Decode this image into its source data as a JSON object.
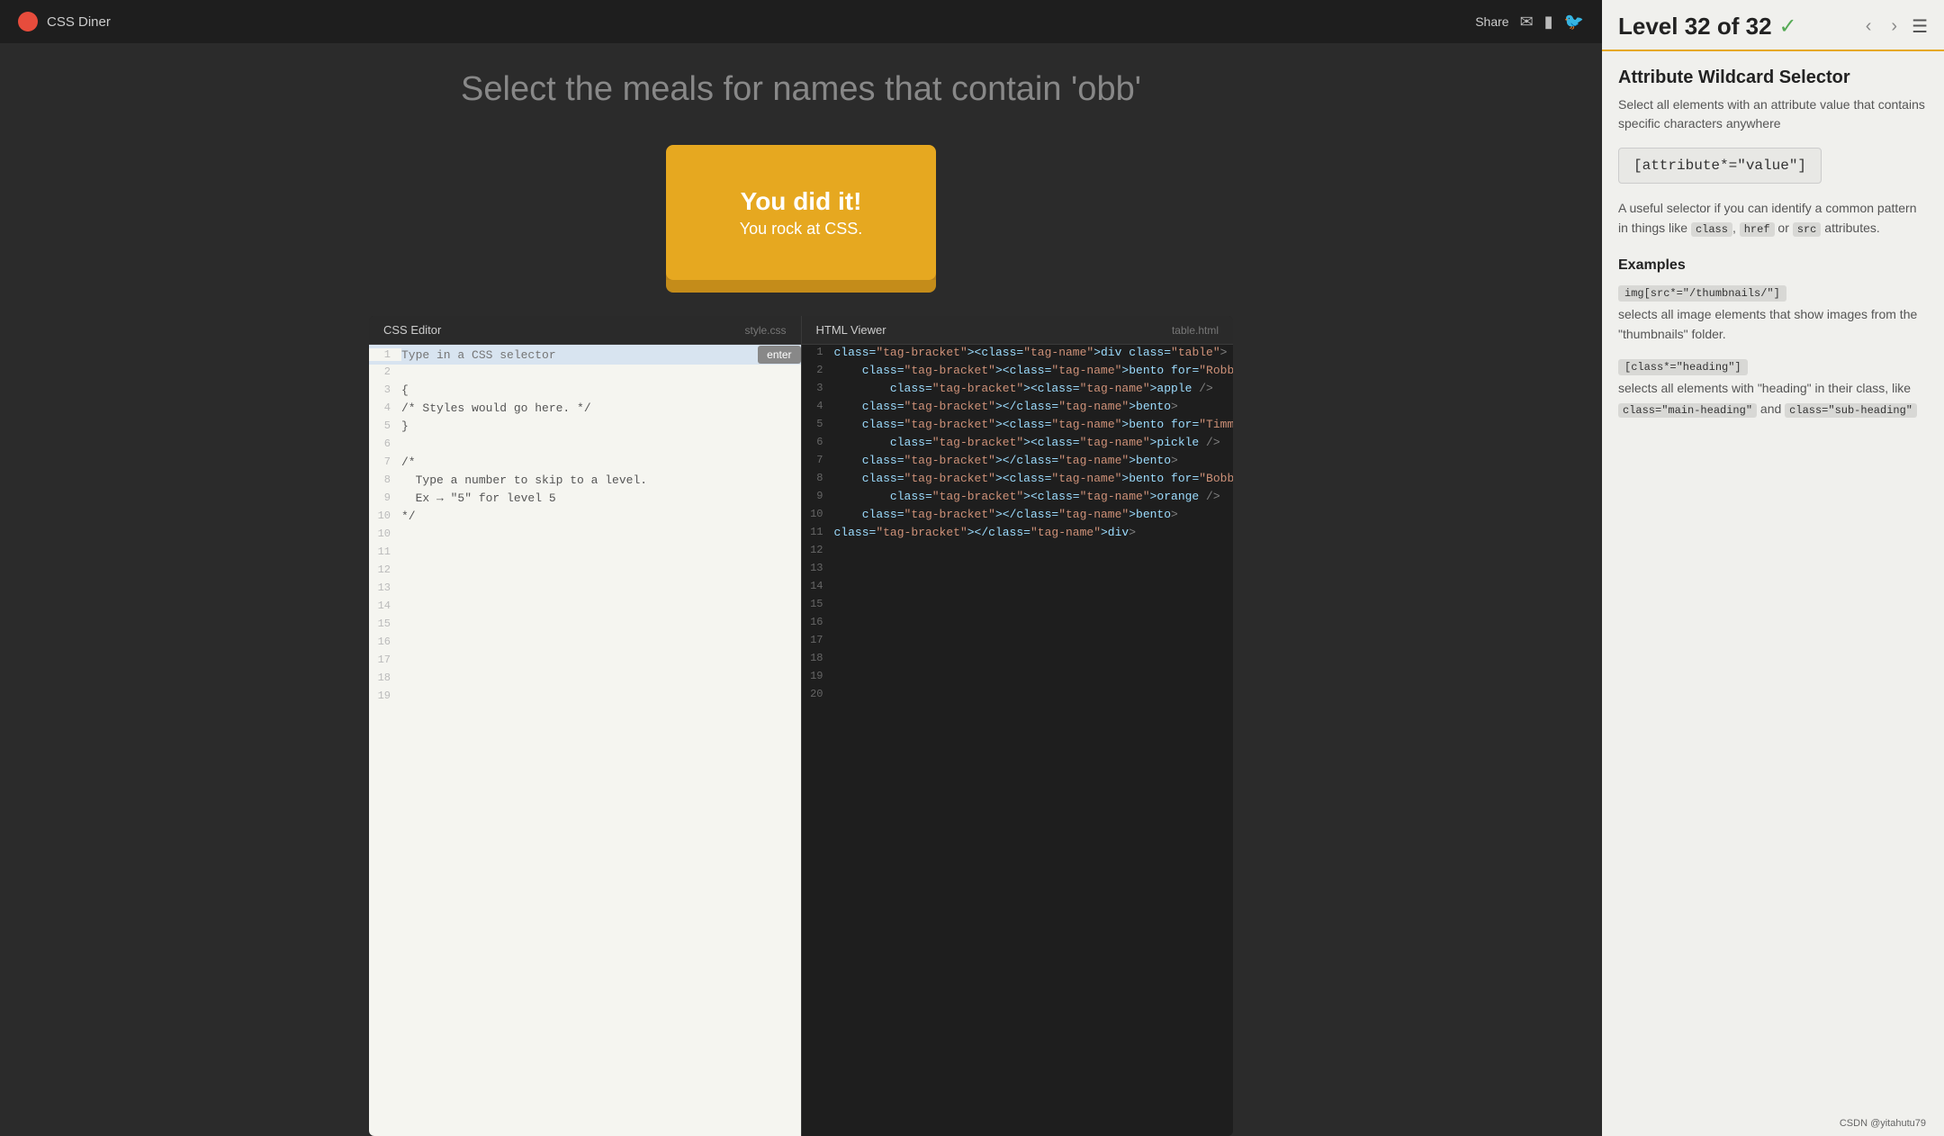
{
  "app": {
    "logo_text": "CSS Diner",
    "share_label": "Share"
  },
  "header": {
    "challenge_title": "Select the meals for names that contain 'obb'"
  },
  "bento": {
    "success_main": "You did it!",
    "success_sub": "You rock at CSS."
  },
  "editor": {
    "left_tab_label": "CSS Editor",
    "left_filename": "style.css",
    "right_tab_label": "HTML Viewer",
    "right_filename": "table.html",
    "input_placeholder": "Type in a CSS selector",
    "enter_label": "enter",
    "css_lines": [
      "",
      "{",
      "/* Styles would go here. */",
      "}",
      "",
      "/*",
      "  Type a number to skip to a level.",
      "  Ex → \"5\" for level 5",
      "*/"
    ],
    "html_lines": [
      "<div class=\"table\">",
      "    <bento for=\"Robbie\">",
      "        <apple />",
      "    </bento>",
      "    <bento for=\"Timmy\">",
      "        <pickle />",
      "    </bento>",
      "    <bento for=\"Bobby\">",
      "        <orange />",
      "    </bento>",
      "</div>"
    ]
  },
  "right_panel": {
    "level_text": "Level 32 of 32",
    "selector_title": "Attribute Wildcard Selector",
    "selector_desc": "Select all elements with an attribute value that contains specific characters anywhere",
    "selector_syntax": "[attribute*=\"value\"]",
    "info_text": "A useful selector if you can identify a common pattern in things like",
    "info_codes": [
      "class",
      "href",
      "src"
    ],
    "info_suffix": "attributes.",
    "examples_title": "Examples",
    "example1_code": "img[src*=\"/thumbnails/\"]",
    "example1_desc": "selects all image elements that show images from the \"thumbnails\" folder.",
    "example2_code": "[class*=\"heading\"]",
    "example2_desc": "selects all elements with \"heading\" in their class, like",
    "example2_code2": "class=\"main-heading\"",
    "example2_and": "and",
    "example2_code3": "class=\"sub-heading\""
  },
  "watermark": "CSDN @yitahutu79"
}
